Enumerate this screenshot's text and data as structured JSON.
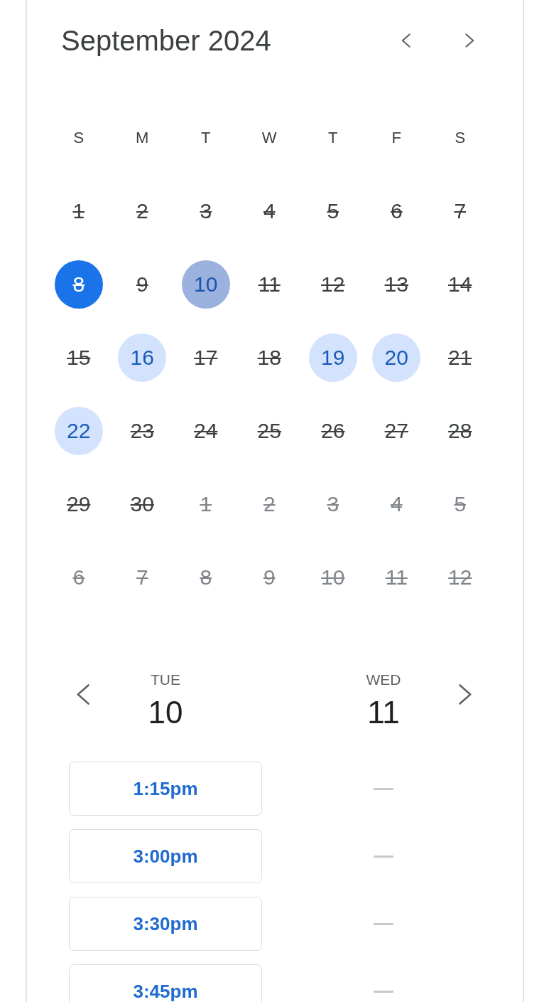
{
  "calendar": {
    "title": "September 2024",
    "weekdays": [
      "S",
      "M",
      "T",
      "W",
      "T",
      "F",
      "S"
    ],
    "weeks": [
      [
        {
          "day": "1",
          "unavailable": true,
          "other_month": false,
          "today": false,
          "selected": false
        },
        {
          "day": "2",
          "unavailable": true,
          "other_month": false,
          "today": false,
          "selected": false
        },
        {
          "day": "3",
          "unavailable": true,
          "other_month": false,
          "today": false,
          "selected": false
        },
        {
          "day": "4",
          "unavailable": true,
          "other_month": false,
          "today": false,
          "selected": false
        },
        {
          "day": "5",
          "unavailable": true,
          "other_month": false,
          "today": false,
          "selected": false
        },
        {
          "day": "6",
          "unavailable": true,
          "other_month": false,
          "today": false,
          "selected": false
        },
        {
          "day": "7",
          "unavailable": true,
          "other_month": false,
          "today": false,
          "selected": false
        }
      ],
      [
        {
          "day": "8",
          "unavailable": true,
          "other_month": false,
          "today": true,
          "selected": false
        },
        {
          "day": "9",
          "unavailable": true,
          "other_month": false,
          "today": false,
          "selected": false
        },
        {
          "day": "10",
          "unavailable": false,
          "other_month": false,
          "today": false,
          "selected": true
        },
        {
          "day": "11",
          "unavailable": true,
          "other_month": false,
          "today": false,
          "selected": false
        },
        {
          "day": "12",
          "unavailable": true,
          "other_month": false,
          "today": false,
          "selected": false
        },
        {
          "day": "13",
          "unavailable": true,
          "other_month": false,
          "today": false,
          "selected": false
        },
        {
          "day": "14",
          "unavailable": true,
          "other_month": false,
          "today": false,
          "selected": false
        }
      ],
      [
        {
          "day": "15",
          "unavailable": true,
          "other_month": false,
          "today": false,
          "selected": false
        },
        {
          "day": "16",
          "unavailable": false,
          "other_month": false,
          "today": false,
          "selected": false
        },
        {
          "day": "17",
          "unavailable": true,
          "other_month": false,
          "today": false,
          "selected": false
        },
        {
          "day": "18",
          "unavailable": true,
          "other_month": false,
          "today": false,
          "selected": false
        },
        {
          "day": "19",
          "unavailable": false,
          "other_month": false,
          "today": false,
          "selected": false
        },
        {
          "day": "20",
          "unavailable": false,
          "other_month": false,
          "today": false,
          "selected": false
        },
        {
          "day": "21",
          "unavailable": true,
          "other_month": false,
          "today": false,
          "selected": false
        }
      ],
      [
        {
          "day": "22",
          "unavailable": false,
          "other_month": false,
          "today": false,
          "selected": false
        },
        {
          "day": "23",
          "unavailable": true,
          "other_month": false,
          "today": false,
          "selected": false
        },
        {
          "day": "24",
          "unavailable": true,
          "other_month": false,
          "today": false,
          "selected": false
        },
        {
          "day": "25",
          "unavailable": true,
          "other_month": false,
          "today": false,
          "selected": false
        },
        {
          "day": "26",
          "unavailable": true,
          "other_month": false,
          "today": false,
          "selected": false
        },
        {
          "day": "27",
          "unavailable": true,
          "other_month": false,
          "today": false,
          "selected": false
        },
        {
          "day": "28",
          "unavailable": true,
          "other_month": false,
          "today": false,
          "selected": false
        }
      ],
      [
        {
          "day": "29",
          "unavailable": true,
          "other_month": false,
          "today": false,
          "selected": false
        },
        {
          "day": "30",
          "unavailable": true,
          "other_month": false,
          "today": false,
          "selected": false
        },
        {
          "day": "1",
          "unavailable": true,
          "other_month": true,
          "today": false,
          "selected": false
        },
        {
          "day": "2",
          "unavailable": true,
          "other_month": true,
          "today": false,
          "selected": false
        },
        {
          "day": "3",
          "unavailable": true,
          "other_month": true,
          "today": false,
          "selected": false
        },
        {
          "day": "4",
          "unavailable": true,
          "other_month": true,
          "today": false,
          "selected": false
        },
        {
          "day": "5",
          "unavailable": true,
          "other_month": true,
          "today": false,
          "selected": false
        }
      ],
      [
        {
          "day": "6",
          "unavailable": true,
          "other_month": true,
          "today": false,
          "selected": false
        },
        {
          "day": "7",
          "unavailable": true,
          "other_month": true,
          "today": false,
          "selected": false
        },
        {
          "day": "8",
          "unavailable": true,
          "other_month": true,
          "today": false,
          "selected": false
        },
        {
          "day": "9",
          "unavailable": true,
          "other_month": true,
          "today": false,
          "selected": false
        },
        {
          "day": "10",
          "unavailable": true,
          "other_month": true,
          "today": false,
          "selected": false
        },
        {
          "day": "11",
          "unavailable": true,
          "other_month": true,
          "today": false,
          "selected": false
        },
        {
          "day": "12",
          "unavailable": true,
          "other_month": true,
          "today": false,
          "selected": false
        }
      ]
    ]
  },
  "schedule": {
    "days": [
      {
        "weekday": "TUE",
        "date": "10",
        "slots": [
          {
            "kind": "time",
            "label": "1:15pm"
          },
          {
            "kind": "time",
            "label": "3:00pm"
          },
          {
            "kind": "time",
            "label": "3:30pm"
          },
          {
            "kind": "time",
            "label": "3:45pm"
          }
        ]
      },
      {
        "weekday": "WED",
        "date": "11",
        "slots": [
          {
            "kind": "empty"
          },
          {
            "kind": "empty"
          },
          {
            "kind": "empty"
          },
          {
            "kind": "empty"
          }
        ]
      }
    ]
  }
}
